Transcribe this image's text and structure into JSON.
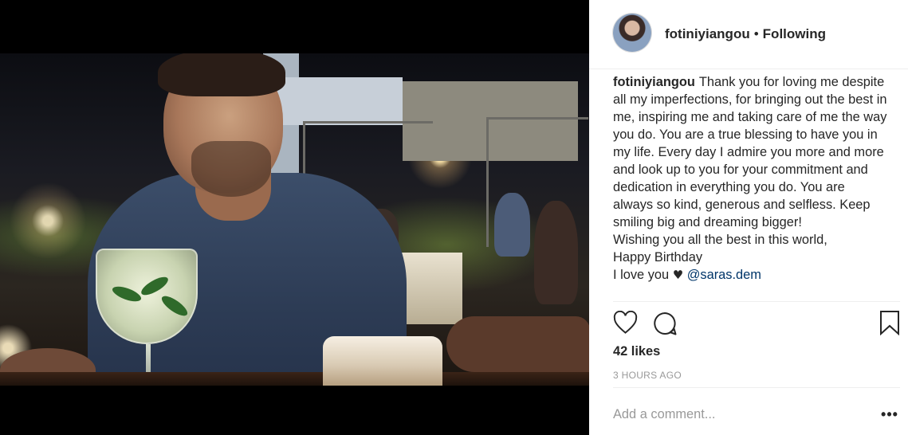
{
  "post": {
    "username": "fotiniyiangou",
    "follow_status": "Following",
    "caption_lines": [
      "Thank you for loving me despite all my imperfections, for bringing out the best in me, inspiring me and taking care of me the way you do. You are a true blessing to have you in my life. Every day I admire you more and more and look up to you for your commitment and dedication in everything you do. You are always so kind, generous and selfless. Keep smiling big and dreaming bigger!",
      "Wishing you all the best in this world,",
      "Happy Birthday",
      "I love you"
    ],
    "heart_glyph": "♥",
    "mention": "@saras.dem",
    "likes": "42 likes",
    "timestamp": "3 HOURS AGO",
    "comment_placeholder": "Add a comment...",
    "more_label": "•••"
  },
  "icons": {
    "like": "heart-outline-icon",
    "comment": "speech-bubble-icon",
    "save": "bookmark-icon",
    "more": "more-options-icon"
  },
  "colors": {
    "text": "#262626",
    "muted": "#999999",
    "mention": "#003569",
    "divider": "#efefef"
  }
}
